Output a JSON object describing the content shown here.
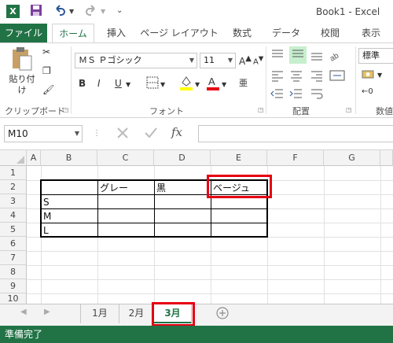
{
  "window": {
    "title": "Book1 - Excel",
    "app_icon": "X"
  },
  "qat": {
    "save_icon": "save-icon",
    "undo_icon": "undo-icon",
    "redo_icon": "redo-icon"
  },
  "tabs": [
    {
      "label": "ファイル"
    },
    {
      "label": "ホーム"
    },
    {
      "label": "挿入"
    },
    {
      "label": "ページ レイアウト"
    },
    {
      "label": "数式"
    },
    {
      "label": "データ"
    },
    {
      "label": "校閲"
    },
    {
      "label": "表示"
    }
  ],
  "ribbon": {
    "clipboard": {
      "paste_label": "貼り付け",
      "group_label": "クリップボード"
    },
    "font": {
      "font_name": "ＭＳ Ｐゴシック",
      "font_size": "11",
      "bold": "B",
      "italic": "I",
      "underline": "U",
      "group_label": "フォント"
    },
    "alignment": {
      "group_label": "配置"
    },
    "number": {
      "format": "標準",
      "group_label": "数値"
    }
  },
  "formula_bar": {
    "name_box": "M10",
    "fx": "fx",
    "content": ""
  },
  "columns": [
    "A",
    "B",
    "C",
    "D",
    "E",
    "F",
    "G"
  ],
  "rows": [
    "1",
    "2",
    "3",
    "4",
    "5",
    "6",
    "7",
    "8",
    "9",
    "10"
  ],
  "cells": {
    "C2": "グレー",
    "D2": "黒",
    "E2": "ベージュ",
    "B3": "S",
    "B4": "M",
    "B5": "L"
  },
  "sheets": [
    {
      "label": "1月"
    },
    {
      "label": "2月"
    },
    {
      "label": "3月"
    }
  ],
  "status": {
    "text": "準備完了"
  },
  "colors": {
    "accent": "#217346",
    "highlight": "#e60012"
  }
}
